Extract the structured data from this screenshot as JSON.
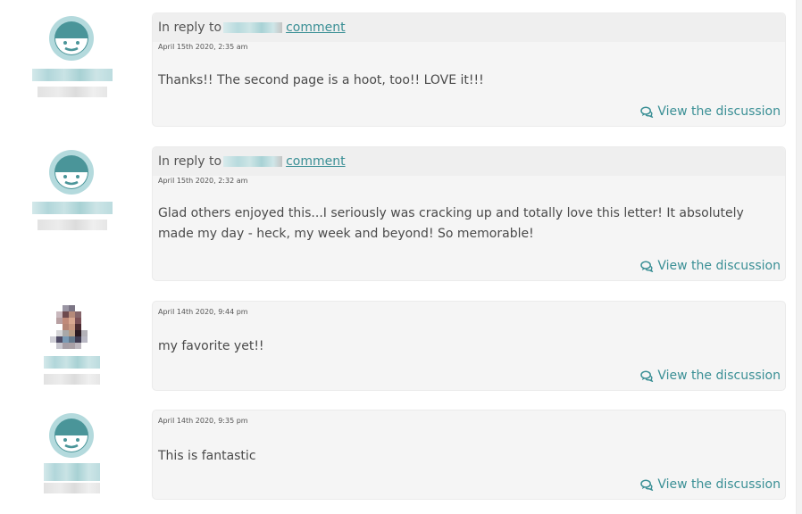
{
  "colors": {
    "accent": "#3a8f95",
    "avatar_ring": "#b4dadd",
    "avatar_face": "#4a9599",
    "card_bg": "#f5f5f5",
    "card_header_bg": "#efefef"
  },
  "comments": [
    {
      "avatar": "default-avatar",
      "in_reply": true,
      "reply_prefix": "In reply to",
      "reply_link": "comment",
      "timestamp": "April 15th 2020, 2:35 am",
      "text": "Thanks!! The second page is a hoot, too!! LOVE it!!!",
      "view_discussion": "View the discussion"
    },
    {
      "avatar": "default-avatar",
      "in_reply": true,
      "reply_prefix": "In reply to",
      "reply_link": "comment",
      "timestamp": "April 15th 2020, 2:32 am",
      "text": "Glad others enjoyed this...I seriously was cracking up and totally love this letter! It absolutely made my day - heck, my week and beyond! So memorable!",
      "view_discussion": "View the discussion"
    },
    {
      "avatar": "photo-avatar",
      "in_reply": false,
      "timestamp": "April 14th 2020, 9:44 pm",
      "text": "my favorite yet!!",
      "view_discussion": "View the discussion"
    },
    {
      "avatar": "default-avatar",
      "in_reply": false,
      "timestamp": "April 14th 2020, 9:35 pm",
      "text": "This is fantastic",
      "view_discussion": "View the discussion"
    }
  ]
}
